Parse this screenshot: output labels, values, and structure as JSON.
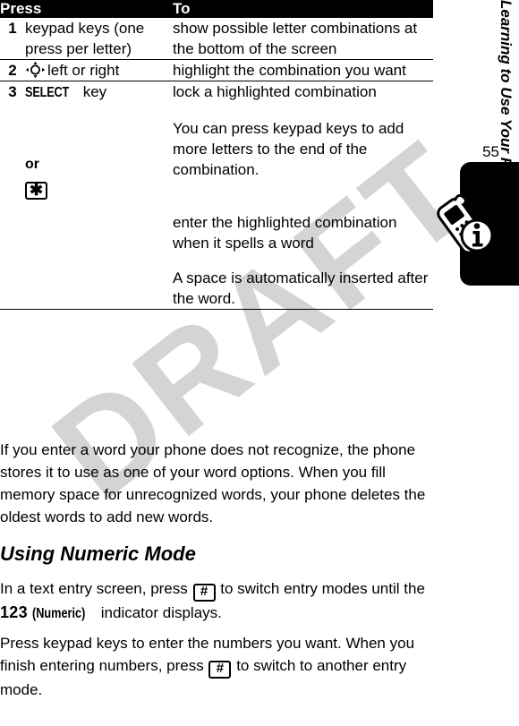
{
  "watermark": {
    "text": "DRAFT"
  },
  "page": {
    "number": "55",
    "chapter_label": "Learning to Use Your Phone"
  },
  "table": {
    "headers": {
      "press": "Press",
      "to": "To"
    },
    "rows": [
      {
        "num": "1",
        "action": "keypad keys (one press per letter)",
        "result": "show possible letter combinations at the bottom of the screen"
      },
      {
        "num": "2",
        "action_icon": "navigation-key-icon",
        "action": "left or right",
        "result": "highlight the combination you want"
      },
      {
        "num": "3",
        "action_key": "SELECT",
        "action": "key",
        "result": "lock a highlighted combination",
        "note": "You can press keypad keys to add more letters to the end of the combination.",
        "or_label": "or",
        "alt_key_icon": "star-key-icon",
        "alt_key_glyph": "✱",
        "alt_result": "enter the highlighted combination when it spells a word",
        "alt_note": "A space is automatically inserted after the word."
      }
    ]
  },
  "body": {
    "paragraph_1": "If you enter a word your phone does not recognize, the phone stores it to use as one of your word options. When you fill memory space for unrecognized words, your phone deletes the oldest words to add new words.",
    "section_heading": "Using Numeric Mode",
    "paragraph_2_part1": "In a text entry screen, press",
    "paragraph_2_key": "#",
    "paragraph_2_part2": "to switch entry modes until the",
    "paragraph_2_indicator": "123",
    "paragraph_2_indicator_name": "(Numeric)",
    "paragraph_2_part3": "indicator displays.",
    "paragraph_3_part1": "Press keypad keys to enter the numbers you want. When you finish entering numbers, press",
    "paragraph_3_key": "#",
    "paragraph_3_part2": "to switch to another entry mode."
  },
  "icons": {
    "navigation_key": "navigation-key-icon",
    "phone_info": "phone-info-icon",
    "star_key": "star-key-icon",
    "pound_key": "pound-key-icon"
  },
  "colors": {
    "header_bg": "#000000",
    "header_text": "#ffffff",
    "text": "#000000",
    "page_bg": "#ffffff",
    "watermark": "rgba(0,0,0,0.17)"
  }
}
